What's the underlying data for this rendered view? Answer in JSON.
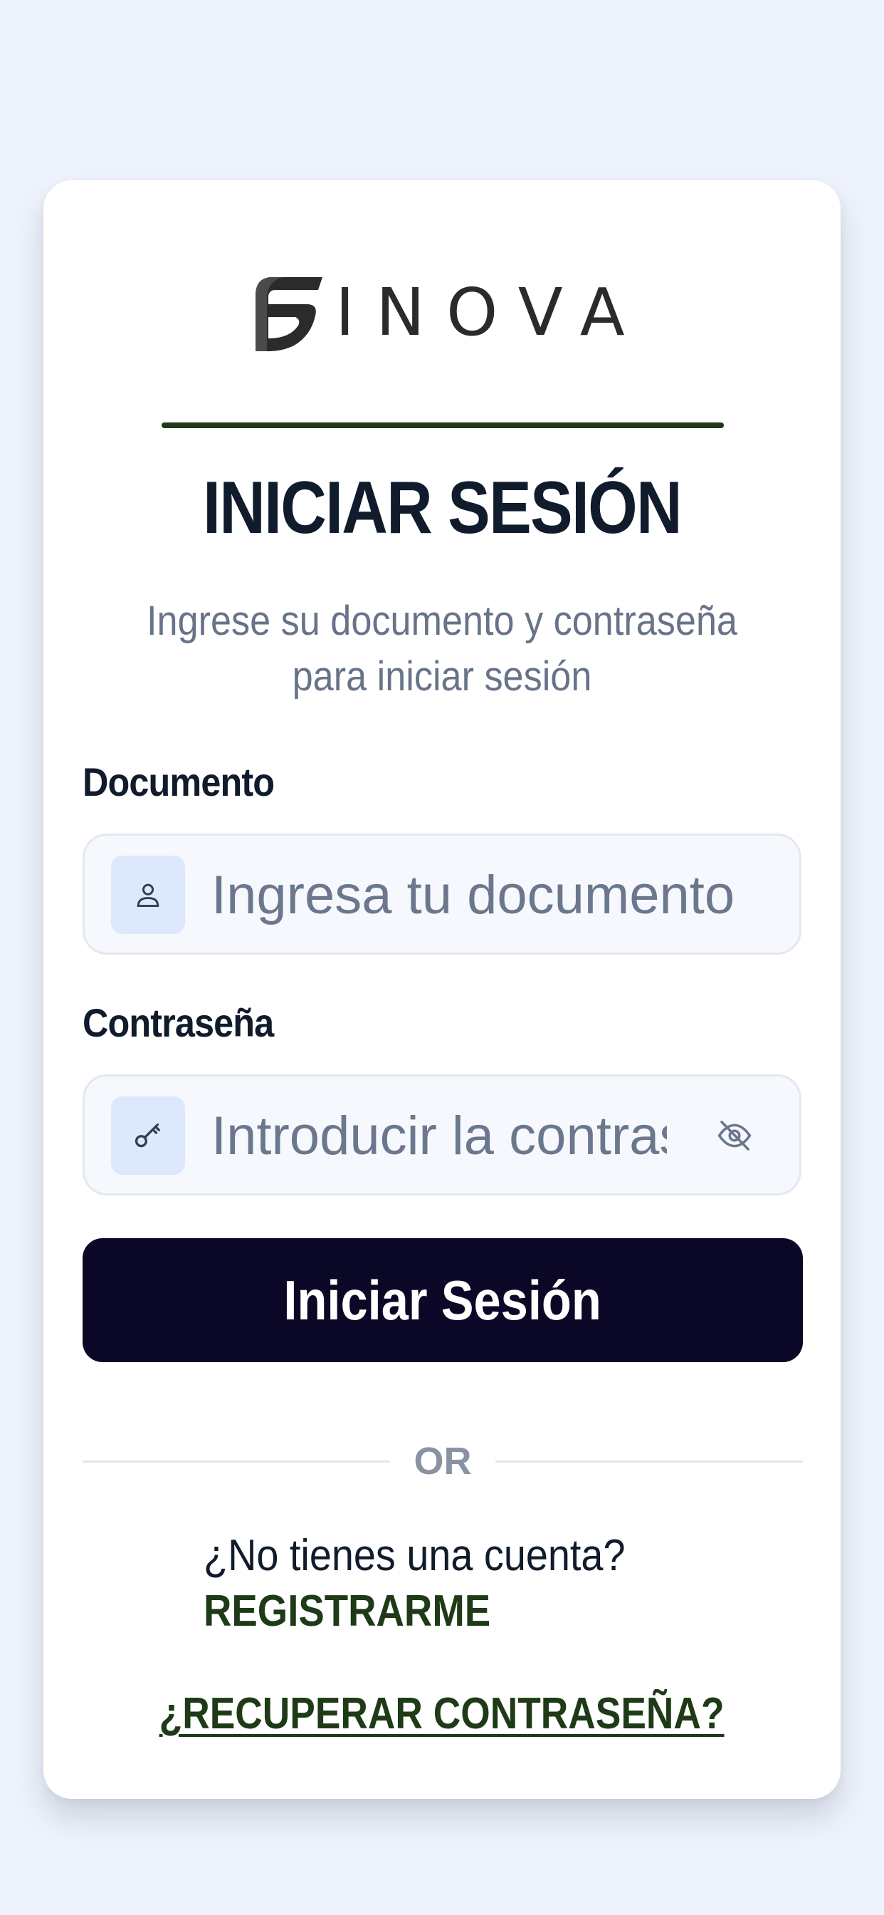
{
  "brand": {
    "name": "INOVA"
  },
  "login": {
    "title": "INICIAR SESIÓN",
    "subtitle_line1": "Ingrese su documento y contraseña",
    "subtitle_line2": "para iniciar sesión",
    "document": {
      "label": "Documento",
      "placeholder": "Ingresa tu documento",
      "value": "",
      "icon": "user-icon"
    },
    "password": {
      "label": "Contraseña",
      "placeholder": "Introducir la contraseña",
      "value": "",
      "icon": "key-icon",
      "toggle_icon": "eye-off-icon"
    },
    "submit_label": "Iniciar Sesión",
    "or_label": "OR",
    "no_account_text": "¿No tienes una cuenta?",
    "register_label": "REGISTRARME",
    "recover_label": "¿RECUPERAR CONTRASEÑA?"
  },
  "colors": {
    "page_background": "#edf2fc",
    "card_background": "#ffffff",
    "primary_button": "#0b0827",
    "accent_green": "#1e3a17",
    "heading": "#101b2c",
    "muted_text": "#677388",
    "icon_box": "#dce8fb",
    "field_background": "#f6f8fd"
  }
}
